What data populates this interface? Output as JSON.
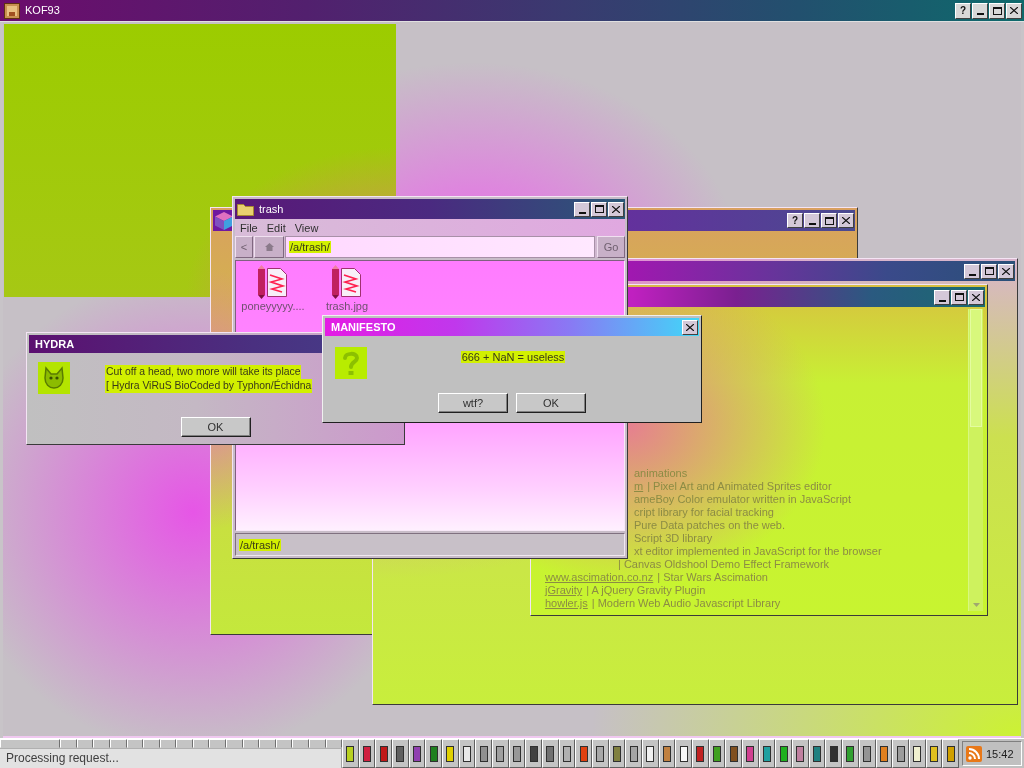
{
  "window": {
    "title": "KOF93",
    "help": "?"
  },
  "cube_window": {
    "help": "?"
  },
  "links_window": {
    "lines": [
      {
        "text": "animations"
      },
      {
        "link": "m",
        "text": "| Pixel Art and Animated Sprites editor"
      },
      {
        "text": "ameBoy Color emulator written in JavaScript"
      },
      {
        "text": "cript library for facial tracking"
      },
      {
        "text": "Pure Data patches on the web."
      },
      {
        "text": "Script 3D library"
      },
      {
        "text": "xt editor implemented in JavaScript for the browser"
      },
      {
        "text": "| Canvas Oldshool Demo Effect Framework"
      },
      {
        "link": "www.ascimation.co.nz",
        "text": "| Star Wars Ascimation"
      },
      {
        "link": "jGravity",
        "text": "| A jQuery Gravity Plugin"
      },
      {
        "link": "howler.js",
        "text": "| Modern Web Audio Javascript Library"
      }
    ]
  },
  "trash_window": {
    "title": "trash",
    "menu": [
      "File",
      "Edit",
      "View"
    ],
    "back": "<",
    "address": "/a/trash/",
    "go": "Go",
    "files": [
      {
        "name": "poneyyyyy...."
      },
      {
        "name": "trash.jpg"
      }
    ],
    "status": "/a/trash/"
  },
  "hydra_dialog": {
    "title": "HYDRA",
    "message": "Cut off a head, two more will take its place",
    "credit": "[ Hydra ViRuS BioCoded by Typhon/Échidna",
    "button": "OK"
  },
  "manifesto_dialog": {
    "title": "MANIFESTO",
    "message": "666 + NaN = useless",
    "buttons": [
      "wtf?",
      "OK"
    ]
  },
  "taskbar": {
    "status": "Processing request...",
    "launchers": [
      {
        "color": "#b8d020"
      },
      {
        "color": "#d02040"
      },
      {
        "color": "#c01818"
      },
      {
        "color": "#606060"
      },
      {
        "color": "#9040b0"
      },
      {
        "color": "#208020"
      },
      {
        "color": "#e0d000"
      },
      {
        "color": "#e8e8e8"
      },
      {
        "color": "#909090"
      },
      {
        "color": "#a0a0a0"
      },
      {
        "color": "#989898"
      },
      {
        "color": "#404040"
      },
      {
        "color": "#707070"
      },
      {
        "color": "#b0b0b0"
      },
      {
        "color": "#e04010"
      },
      {
        "color": "#a8a8a8"
      },
      {
        "color": "#808040"
      },
      {
        "color": "#a4a4a4"
      },
      {
        "color": "#f0f0f0"
      },
      {
        "color": "#c08040"
      },
      {
        "color": "#f8f8f8"
      },
      {
        "color": "#c02020"
      },
      {
        "color": "#40a020"
      },
      {
        "color": "#805020"
      },
      {
        "color": "#d04090"
      },
      {
        "color": "#20a0a0"
      },
      {
        "color": "#20b020"
      },
      {
        "color": "#c080a0"
      },
      {
        "color": "#208080"
      },
      {
        "color": "#303030"
      },
      {
        "color": "#30a030"
      },
      {
        "color": "#949494"
      },
      {
        "color": "#e08020"
      },
      {
        "color": "#9c9c9c"
      },
      {
        "color": "#f0f0d0"
      },
      {
        "color": "#e0c020"
      },
      {
        "color": "#d0a000"
      }
    ],
    "clock": "15:42"
  }
}
